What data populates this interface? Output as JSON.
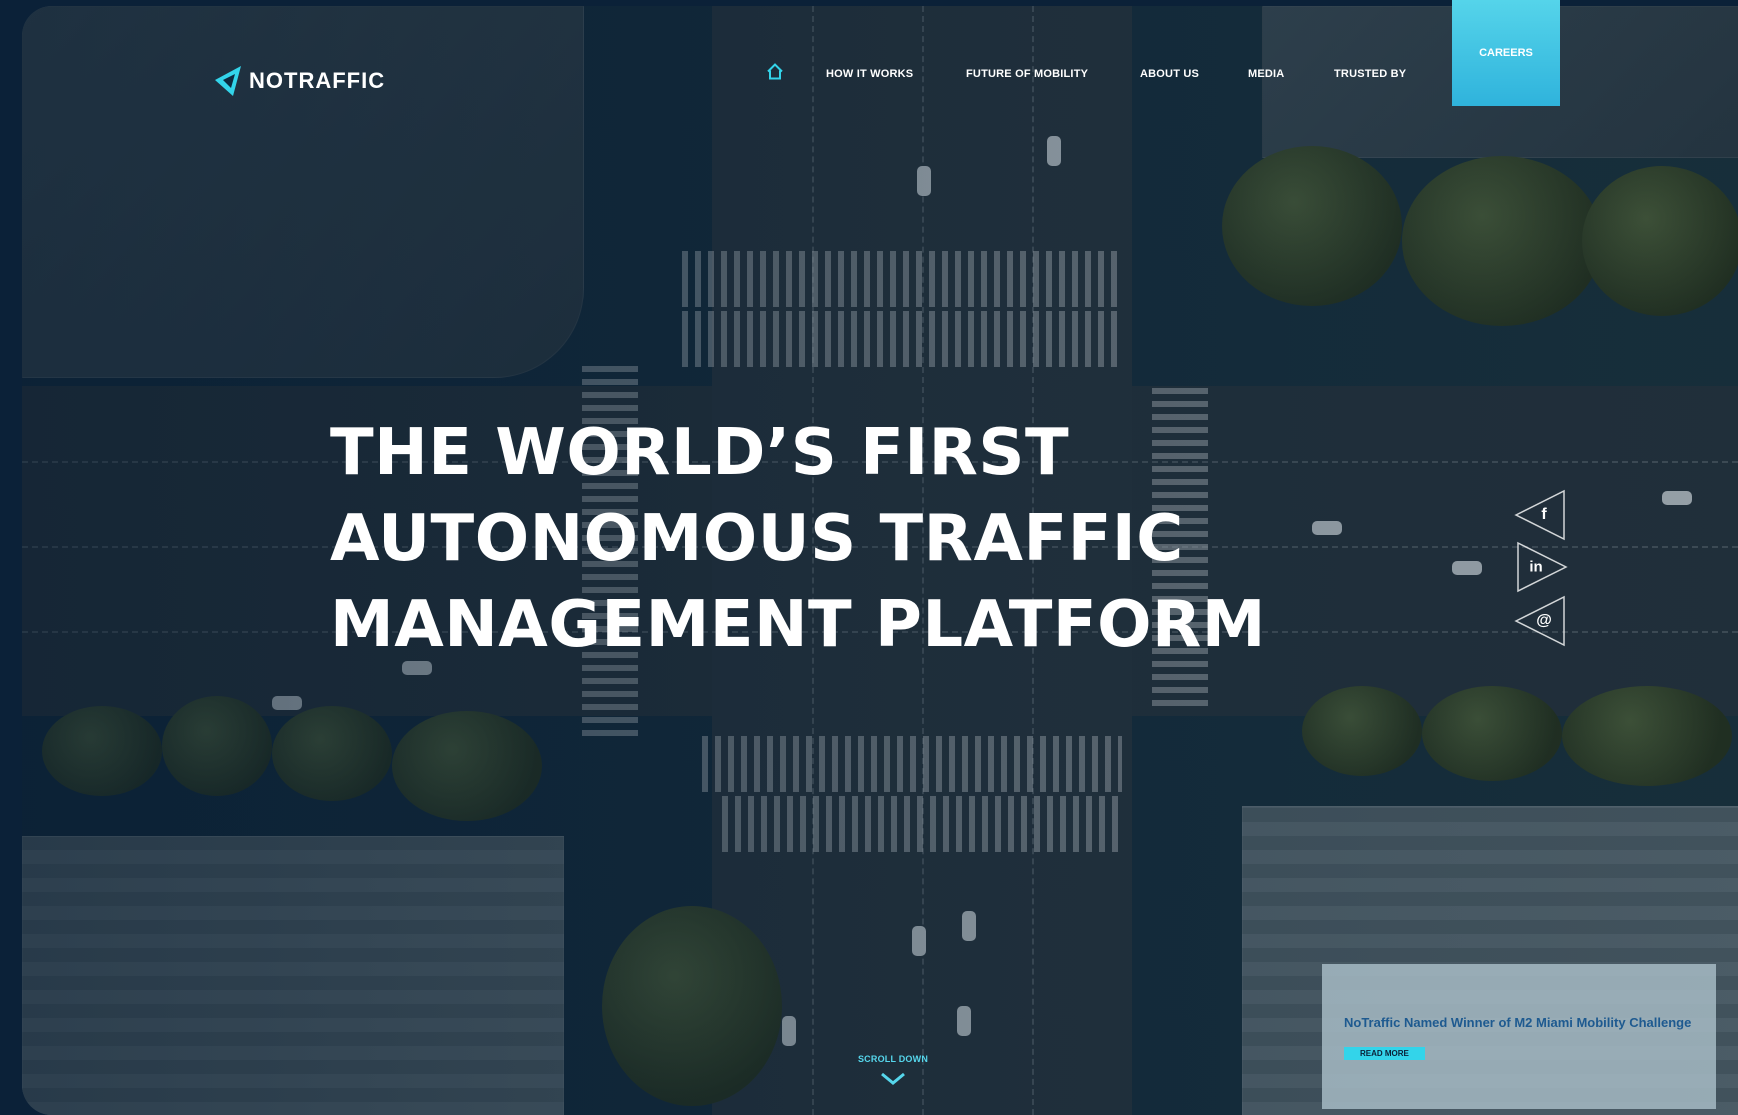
{
  "brand": {
    "name": "NOTRAFFIC",
    "accent": "#33d4ea",
    "background": "#0b2138"
  },
  "nav": {
    "home_icon": "home-icon",
    "items": [
      {
        "label": "HOW IT WORKS"
      },
      {
        "label": "FUTURE OF MOBILITY"
      },
      {
        "label": "ABOUT US"
      },
      {
        "label": "MEDIA"
      },
      {
        "label": "TRUSTED BY"
      }
    ],
    "cta": "CAREERS"
  },
  "hero": {
    "lines": [
      "THE WORLD’S FIRST",
      "AUTONOMOUS TRAFFIC",
      "MANAGEMENT PLATFORM"
    ]
  },
  "social": [
    {
      "icon": "facebook-icon",
      "glyph": "f"
    },
    {
      "icon": "linkedin-icon",
      "glyph": "in"
    },
    {
      "icon": "email-icon",
      "glyph": "@"
    }
  ],
  "scroll": {
    "label": "SCROLL DOWN",
    "icon": "chevron-down-icon"
  },
  "news": {
    "title": "NoTraffic Named Winner of M2 Miami Mobility Challenge",
    "cta": "READ MORE"
  }
}
